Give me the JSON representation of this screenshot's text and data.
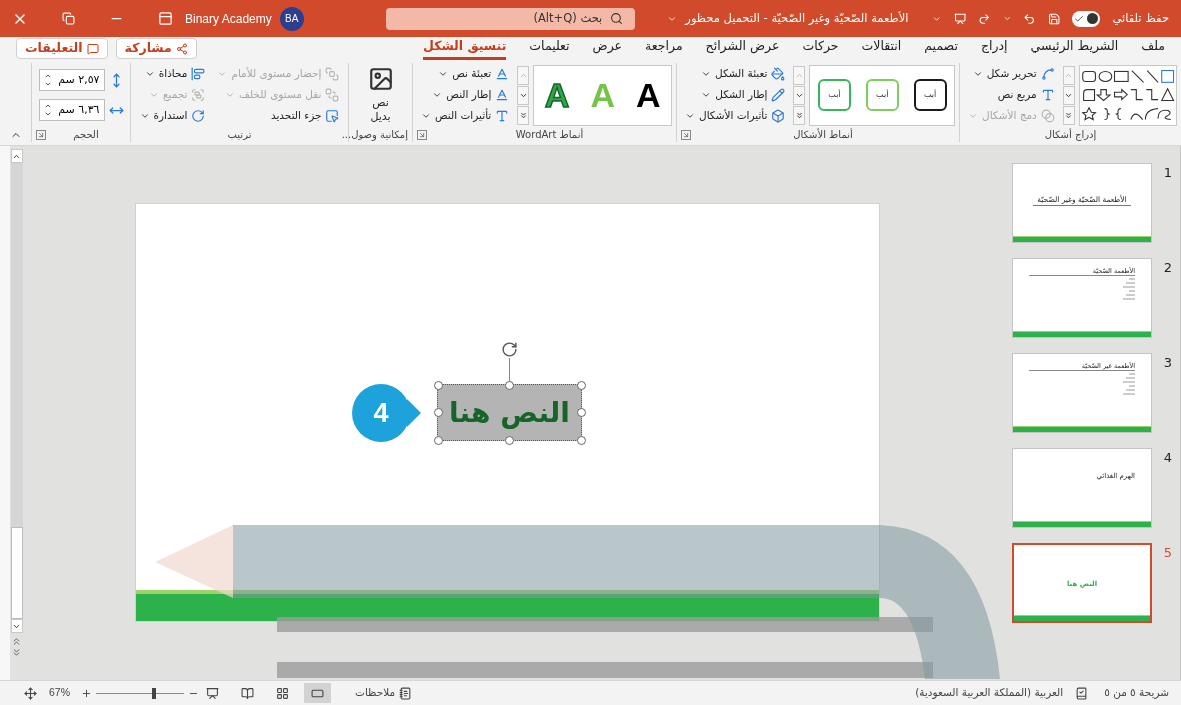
{
  "title_bar": {
    "autosave_label": "حفظ تلقائي",
    "autosave_on": true,
    "document_title": "الأطعمة الصّحيّة وغير الصّحيّة - التحميل محظور",
    "search_placeholder": "بحث (Alt+Q)",
    "user_initials": "BA",
    "user_name": "Binary Academy"
  },
  "tabs": [
    {
      "label": "ملف",
      "selected": false
    },
    {
      "label": "الشريط الرئيسي",
      "selected": false
    },
    {
      "label": "إدراج",
      "selected": false
    },
    {
      "label": "تصميم",
      "selected": false
    },
    {
      "label": "انتقالات",
      "selected": false
    },
    {
      "label": "حركات",
      "selected": false
    },
    {
      "label": "عرض الشرائح",
      "selected": false
    },
    {
      "label": "مراجعة",
      "selected": false
    },
    {
      "label": "عرض",
      "selected": false
    },
    {
      "label": "تعليمات",
      "selected": false
    },
    {
      "label": "تنسيق الشكل",
      "selected": true
    }
  ],
  "share_button": "مشاركة",
  "comments_button": "التعليقات",
  "ribbon": {
    "groups": [
      {
        "kind": "shapes",
        "label": "إدراج أشكال",
        "launcher": false,
        "commands": [
          {
            "label": "تحرير شكل",
            "dropdown": true,
            "disabled": false
          },
          {
            "label": "مربع نص",
            "dropdown": false,
            "disabled": false
          },
          {
            "label": "دمج الأشكال",
            "dropdown": true,
            "disabled": true
          }
        ]
      },
      {
        "kind": "styles",
        "label": "أنماط الأشكال",
        "launcher": true,
        "gallery": [
          {
            "label": "أبب",
            "color": "#1a1a1a"
          },
          {
            "label": "أبب",
            "color": "#7ccf5b"
          },
          {
            "label": "أبب",
            "color": "#3bb55a"
          }
        ],
        "commands": [
          {
            "label": "تعبئة الشكل",
            "dropdown": true,
            "disabled": false
          },
          {
            "label": "إطار الشكل",
            "dropdown": true,
            "disabled": false
          },
          {
            "label": "تأثيرات الأشكال",
            "dropdown": true,
            "disabled": false
          }
        ]
      },
      {
        "kind": "wordart",
        "label": "أنماط WordArt",
        "launcher": true,
        "gallery": [
          {
            "label": "A",
            "kind": "fill",
            "color": "#000000"
          },
          {
            "label": "A",
            "kind": "fill",
            "color": "#74c34a"
          },
          {
            "label": "A",
            "kind": "outline",
            "color": "#2ea84a"
          }
        ],
        "commands": [
          {
            "label": "تعبئة نص",
            "dropdown": true,
            "disabled": false
          },
          {
            "label": "إطار النص",
            "dropdown": true,
            "disabled": false
          },
          {
            "label": "تأثيرات النص",
            "dropdown": true,
            "disabled": false
          }
        ]
      },
      {
        "kind": "button",
        "label": "إمكانية وصول...",
        "launcher": false,
        "button": "نص بديل"
      },
      {
        "kind": "arrange",
        "label": "ترتيب",
        "launcher": false,
        "commands": [
          {
            "label": "إحضار مستوى للأمام",
            "dropdown": true,
            "disabled": true
          },
          {
            "label": "نقل مستوى للخلف",
            "dropdown": true,
            "disabled": true
          },
          {
            "label": "جزء التحديد",
            "dropdown": false,
            "disabled": false
          },
          {
            "label": "محاذاة",
            "dropdown": true,
            "disabled": false
          },
          {
            "label": "تجميع",
            "dropdown": true,
            "disabled": true
          },
          {
            "label": "استدارة",
            "dropdown": true,
            "disabled": false
          }
        ]
      },
      {
        "kind": "size",
        "label": "الحجم",
        "launcher": true,
        "fields": [
          {
            "value": "٢,٥٧ سم"
          },
          {
            "value": "٦,٣٦ سم"
          }
        ]
      }
    ]
  },
  "slide": {
    "text_box": "النص هنا"
  },
  "callout": "4",
  "thumbnails": [
    {
      "number": "1",
      "title": "الأطعمة الصّحيّة وغير الصّحيّة",
      "kind": "title",
      "selected": false
    },
    {
      "number": "2",
      "title": "الأطعمة الصّحيّة",
      "kind": "heading-list",
      "selected": false
    },
    {
      "number": "3",
      "title": "الأطعمة غير الصّحيّة",
      "kind": "heading-list",
      "selected": false
    },
    {
      "number": "4",
      "title": "الهرم الغذائي",
      "kind": "heading",
      "selected": false
    },
    {
      "number": "5",
      "title": "النص هنا",
      "kind": "centered",
      "selected": true
    }
  ],
  "status_bar": {
    "slide_counter": "شريحة ٥ من ٥",
    "language": "العربية (المملكة العربية السعودية)",
    "notes": "ملاحظات",
    "views": [
      {
        "selected": true
      },
      {
        "selected": false
      },
      {
        "selected": false
      },
      {
        "selected": false
      }
    ],
    "zoom": "67%",
    "zoom_slider": {
      "level": 0.66
    }
  }
}
